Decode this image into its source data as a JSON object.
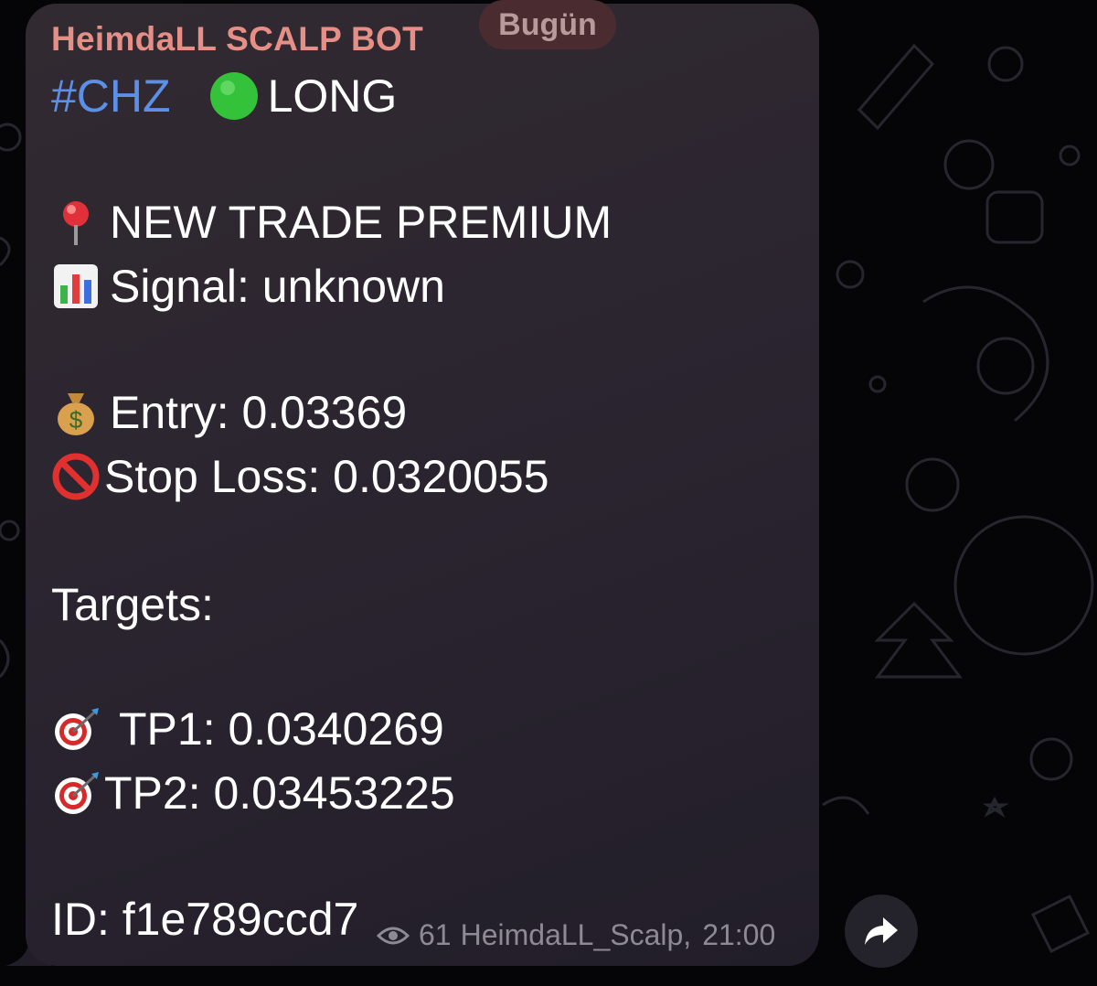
{
  "channel": {
    "sender_name": "HeimdaLL SCALP BOT",
    "date_label": "Bugün"
  },
  "message": {
    "hashtag": "#CHZ",
    "direction": "LONG",
    "header": "NEW TRADE PREMIUM",
    "signal": "Signal: unknown",
    "entry": "Entry: 0.03369",
    "stop_loss": "Stop Loss: 0.0320055",
    "targets_label": "Targets:",
    "tp1": "TP1: 0.0340269",
    "tp2": "TP2: 0.03453225",
    "id_line": "ID: f1e789ccd7"
  },
  "meta": {
    "views": "61",
    "author": "HeimdaLL_Scalp,",
    "time": "21:00"
  },
  "icons": {
    "direction": "green-circle-icon",
    "header": "pushpin-icon",
    "signal": "bar-chart-icon",
    "entry": "money-bag-icon",
    "stop_loss": "prohibited-icon",
    "targets": "direct-hit-icon",
    "views": "eye-icon",
    "share": "share-arrow-icon"
  },
  "colors": {
    "sender": "#e58f86",
    "hashtag": "#5c8fe6",
    "bubble": "#2b2530",
    "meta": "#8e8a93",
    "background": "#050507",
    "direction_dot": "#34c23a"
  }
}
